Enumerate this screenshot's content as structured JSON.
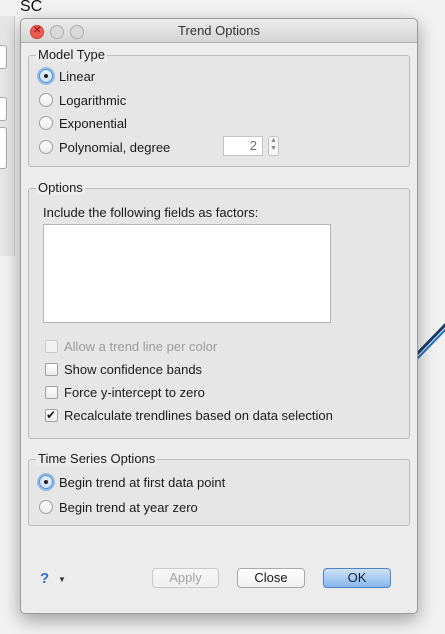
{
  "background": {
    "title": "SC"
  },
  "dialog": {
    "title": "Trend Options",
    "model_type": {
      "group_title": "Model Type",
      "options": [
        {
          "label": "Linear",
          "selected": true
        },
        {
          "label": "Logarithmic",
          "selected": false
        },
        {
          "label": "Exponential",
          "selected": false
        },
        {
          "label": "Polynomial, degree",
          "selected": false
        }
      ],
      "degree_value": "2"
    },
    "options": {
      "group_title": "Options",
      "factors_label": "Include the following fields as factors:",
      "checkboxes": [
        {
          "label": "Allow a trend line per color",
          "checked": false,
          "disabled": true
        },
        {
          "label": "Show confidence bands",
          "checked": false,
          "disabled": false
        },
        {
          "label": "Force y-intercept to zero",
          "checked": false,
          "disabled": false
        },
        {
          "label": "Recalculate trendlines based on data selection",
          "checked": true,
          "disabled": false
        }
      ]
    },
    "time_series": {
      "group_title": "Time Series Options",
      "options": [
        {
          "label": "Begin trend at first data point",
          "selected": true
        },
        {
          "label": "Begin trend at year zero",
          "selected": false
        }
      ]
    },
    "buttons": {
      "help": "?",
      "apply": "Apply",
      "close": "Close",
      "ok": "OK"
    }
  }
}
